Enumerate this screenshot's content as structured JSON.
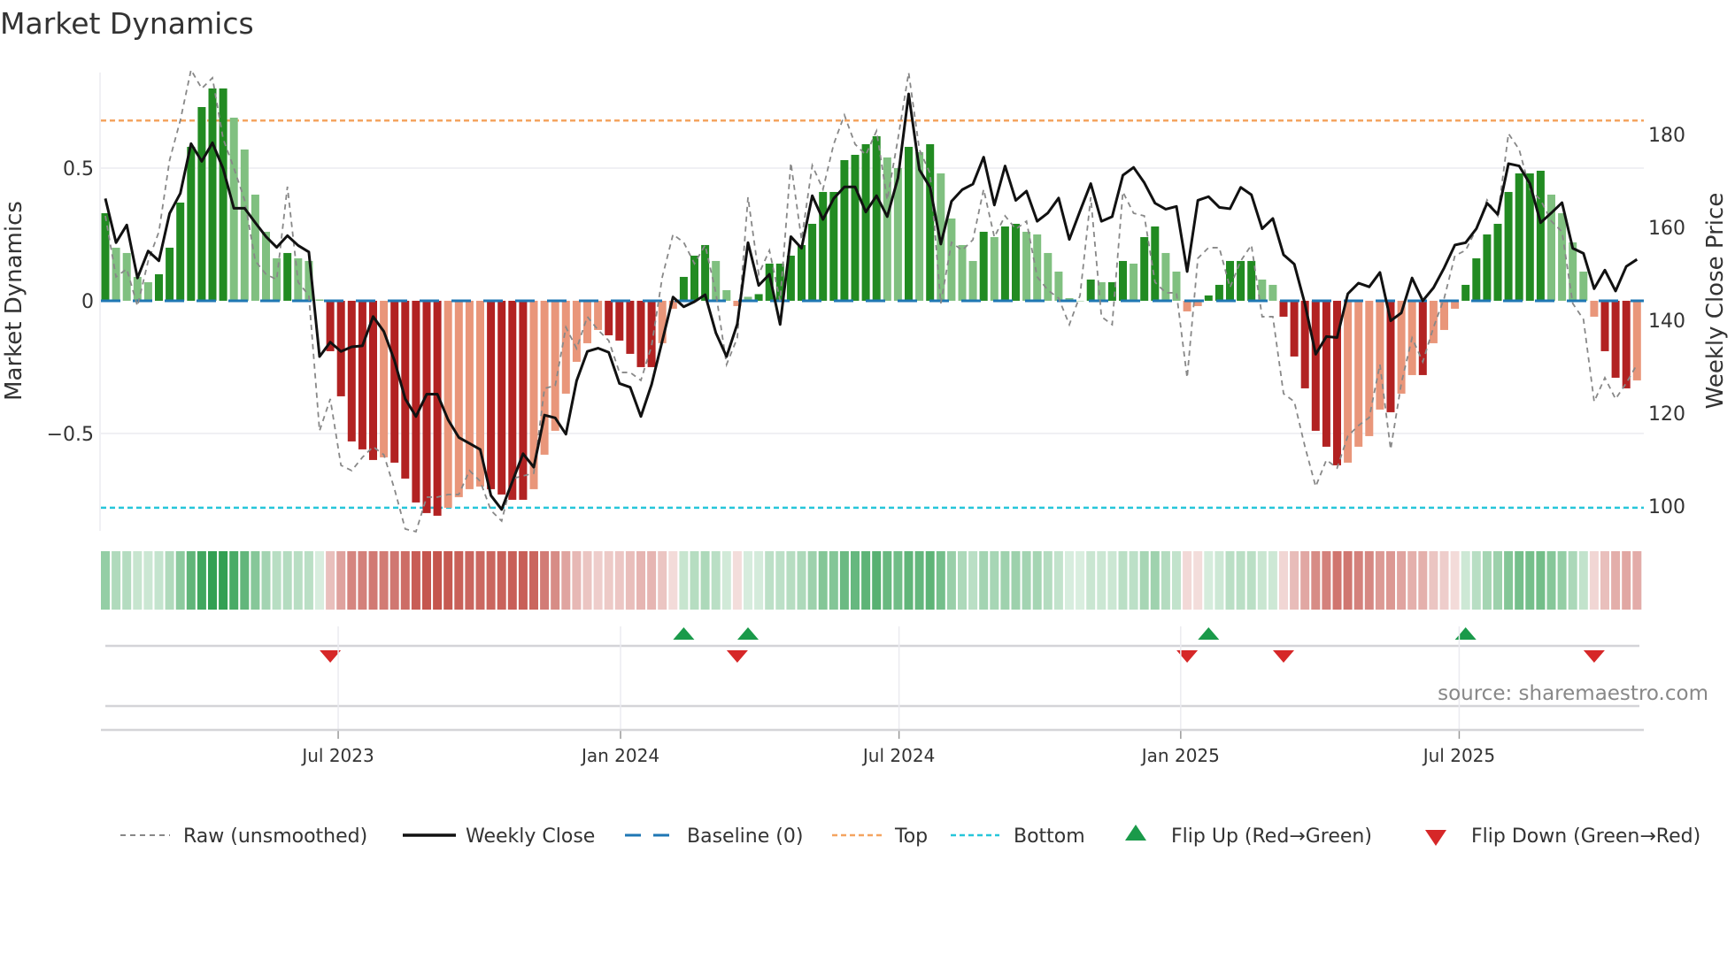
{
  "title": "Market Dynamics",
  "source": "source: sharemaestro.com",
  "colors": {
    "green_dark": "#228b22",
    "green_light": "#80c080",
    "red_dark": "#b22222",
    "red_light": "#e9967a",
    "strip_green": "#2e9e4f",
    "strip_red": "#c4534b",
    "top": "#f4a460",
    "bottom": "#26c6da",
    "baseline": "#1f77b4",
    "raw": "#888888",
    "close": "#111111",
    "flip_up": "#1a9a4a",
    "flip_down": "#d62728"
  },
  "chart_data": {
    "type": "bar",
    "title": "Market Dynamics",
    "ylabel": "Market Dynamics",
    "y2label": "Weekly Close Price",
    "ylim": [
      -0.867,
      0.86
    ],
    "y2lim": [
      94.7,
      193.3
    ],
    "grid": true,
    "legend_position": "bottom",
    "yticks": [
      {
        "value": 0.5,
        "label": "0.5"
      },
      {
        "value": 0,
        "label": "0"
      },
      {
        "value": -0.5,
        "label": "−0.5"
      }
    ],
    "y2ticks": [
      {
        "value": 180,
        "label": "180"
      },
      {
        "value": 160,
        "label": "160"
      },
      {
        "value": 140,
        "label": "140"
      },
      {
        "value": 120,
        "label": "120"
      },
      {
        "value": 100,
        "label": "100"
      }
    ],
    "x_ticks": [
      {
        "label": "Jul 2023",
        "week": 21.74
      },
      {
        "label": "Jan 2024",
        "week": 48.1
      },
      {
        "label": "Jul 2024",
        "week": 74.1
      },
      {
        "label": "Jan 2025",
        "week": 100.4
      },
      {
        "label": "Jul 2025",
        "week": 126.4
      }
    ],
    "top_threshold": 0.679,
    "bottom_threshold": -0.78,
    "baseline": 0,
    "dynamics": [
      0.33,
      0.2,
      0.18,
      0.09,
      0.07,
      0.1,
      0.2,
      0.37,
      0.58,
      0.73,
      0.8,
      0.8,
      0.69,
      0.57,
      0.4,
      0.26,
      0.16,
      0.18,
      0.16,
      0.15,
      0.005,
      -0.19,
      -0.36,
      -0.53,
      -0.56,
      -0.6,
      -0.59,
      -0.61,
      -0.67,
      -0.76,
      -0.8,
      -0.81,
      -0.78,
      -0.74,
      -0.71,
      -0.7,
      -0.71,
      -0.73,
      -0.75,
      -0.75,
      -0.71,
      -0.58,
      -0.49,
      -0.35,
      -0.23,
      -0.16,
      -0.11,
      -0.13,
      -0.15,
      -0.2,
      -0.25,
      -0.25,
      -0.16,
      -0.03,
      0.09,
      0.17,
      0.21,
      0.15,
      0.04,
      -0.02,
      0.015,
      0.025,
      0.14,
      0.14,
      0.17,
      0.21,
      0.29,
      0.41,
      0.41,
      0.53,
      0.55,
      0.59,
      0.62,
      0.54,
      0.5,
      0.58,
      0.56,
      0.59,
      0.48,
      0.31,
      0.21,
      0.15,
      0.26,
      0.24,
      0.28,
      0.29,
      0.26,
      0.25,
      0.18,
      0.11,
      0.01,
      0.0,
      0.08,
      0.07,
      0.07,
      0.15,
      0.14,
      0.24,
      0.28,
      0.18,
      0.11,
      -0.04,
      -0.02,
      0.02,
      0.06,
      0.15,
      0.15,
      0.15,
      0.08,
      0.06,
      -0.06,
      -0.21,
      -0.33,
      -0.49,
      -0.55,
      -0.62,
      -0.61,
      -0.55,
      -0.51,
      -0.41,
      -0.42,
      -0.35,
      -0.28,
      -0.28,
      -0.16,
      -0.11,
      -0.03,
      0.06,
      0.16,
      0.25,
      0.29,
      0.41,
      0.48,
      0.48,
      0.49,
      0.4,
      0.33,
      0.22,
      0.11,
      -0.06,
      -0.19,
      -0.29,
      -0.33,
      -0.3
    ],
    "raw": [
      0.32,
      0.09,
      0.12,
      -0.02,
      0.15,
      0.26,
      0.53,
      0.68,
      0.87,
      0.8,
      0.84,
      0.61,
      0.5,
      0.38,
      0.15,
      0.1,
      0.08,
      0.43,
      0.07,
      0.02,
      -0.49,
      -0.37,
      -0.62,
      -0.64,
      -0.59,
      -0.55,
      -0.58,
      -0.71,
      -0.86,
      -0.87,
      -0.74,
      -0.74,
      -0.73,
      -0.73,
      -0.64,
      -0.68,
      -0.79,
      -0.83,
      -0.67,
      -0.66,
      -0.65,
      -0.33,
      -0.32,
      -0.1,
      -0.18,
      -0.06,
      -0.11,
      -0.15,
      -0.27,
      -0.27,
      -0.3,
      -0.17,
      0.09,
      0.25,
      0.22,
      0.14,
      0.21,
      0.03,
      -0.24,
      -0.14,
      0.39,
      0.1,
      0.19,
      0.0,
      0.52,
      0.23,
      0.51,
      0.42,
      0.59,
      0.7,
      0.59,
      0.55,
      0.64,
      0.38,
      0.61,
      0.86,
      0.57,
      0.48,
      -0.01,
      0.22,
      0.19,
      0.23,
      0.42,
      0.24,
      0.32,
      0.27,
      0.3,
      0.09,
      0.04,
      0.01,
      -0.09,
      0.02,
      0.39,
      -0.06,
      -0.09,
      0.41,
      0.33,
      0.32,
      0.07,
      0.03,
      0.03,
      -0.29,
      0.16,
      0.2,
      0.2,
      0.05,
      0.15,
      0.21,
      -0.06,
      -0.06,
      -0.35,
      -0.38,
      -0.55,
      -0.7,
      -0.6,
      -0.63,
      -0.51,
      -0.47,
      -0.44,
      -0.24,
      -0.56,
      -0.31,
      -0.14,
      -0.23,
      -0.1,
      0.01,
      0.17,
      0.19,
      0.27,
      0.38,
      0.32,
      0.63,
      0.57,
      0.42,
      0.38,
      0.3,
      0.26,
      -0.01,
      -0.07,
      -0.38,
      -0.29,
      -0.37,
      -0.31,
      -0.24
    ],
    "weekly_close": [
      166.2,
      156.7,
      160.5,
      149.1,
      154.9,
      152.8,
      163.0,
      167.3,
      178.0,
      174.2,
      178.2,
      172.6,
      164.1,
      164.1,
      161.0,
      158.0,
      155.7,
      158.2,
      156.1,
      154.7,
      132.2,
      135.3,
      133.3,
      134.3,
      134.5,
      140.8,
      137.6,
      131.3,
      123.1,
      119.3,
      124.1,
      124.1,
      118.6,
      114.8,
      113.5,
      112.2,
      102.3,
      99.3,
      105.3,
      111.3,
      108.4,
      119.6,
      119.0,
      115.5,
      127.0,
      133.3,
      134.0,
      133.1,
      126.4,
      125.6,
      119.3,
      126.2,
      135.6,
      145.0,
      142.9,
      144.0,
      145.5,
      137.3,
      132.2,
      139.2,
      156.7,
      147.5,
      149.9,
      139.1,
      158.0,
      155.5,
      166.8,
      161.7,
      166.2,
      168.7,
      168.7,
      163.3,
      166.8,
      162.3,
      170.6,
      188.7,
      172.4,
      168.6,
      156.4,
      165.6,
      168.1,
      169.3,
      175.1,
      164.8,
      173.2,
      165.8,
      167.8,
      161.3,
      163.1,
      166.3,
      157.4,
      163.5,
      169.4,
      161.3,
      162.3,
      171.2,
      172.9,
      169.6,
      165.2,
      163.9,
      164.5,
      150.5,
      165.8,
      166.6,
      164.3,
      164.0,
      168.6,
      167.0,
      159.7,
      161.9,
      154.1,
      152.1,
      143.5,
      132.7,
      136.5,
      136.3,
      145.7,
      148.0,
      147.2,
      150.3,
      139.9,
      141.6,
      149.1,
      144.2,
      147.0,
      151.3,
      156.2,
      156.7,
      159.7,
      165.2,
      162.8,
      173.7,
      173.2,
      169.4,
      161.0,
      163.1,
      165.3,
      155.5,
      154.4,
      146.8,
      150.8,
      146.3,
      151.6,
      153.1
    ],
    "flips_up": [
      54,
      60,
      103,
      127
    ],
    "flips_down": [
      21,
      59,
      101,
      110,
      139
    ],
    "legend": {
      "raw": "Raw (unsmoothed)",
      "close": "Weekly Close",
      "baseline": "Baseline (0)",
      "top": "Top",
      "bottom": "Bottom",
      "flip_up": "Flip Up (Red→Green)",
      "flip_down": "Flip Down (Green→Red)"
    }
  }
}
